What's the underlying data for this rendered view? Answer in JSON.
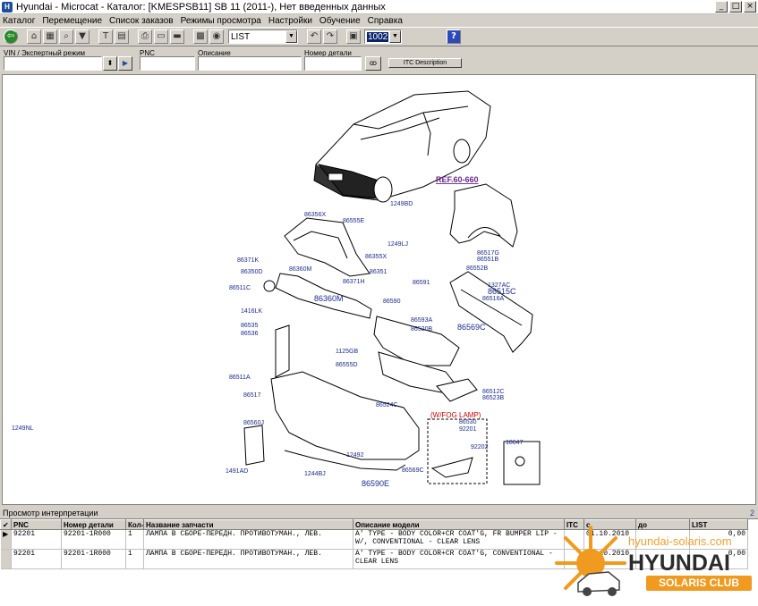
{
  "window": {
    "title": "Hyundai - Microcat - Каталог: [KMESPSB11] SB 11 (2011-), Нет введенных данных"
  },
  "menu": [
    "Каталог",
    "Перемещение",
    "Список заказов",
    "Режимы просмотра",
    "Настройки",
    "Обучение",
    "Справка"
  ],
  "toolbar": {
    "list_value": "LIST",
    "selected_value": "1002"
  },
  "filter": {
    "vin_label": "VIN / Экспертный режим",
    "pnc_label": "PNC",
    "desc_label": "Описание",
    "part_label": "Номер детали",
    "itc_button": "ITC Description"
  },
  "diagram": {
    "callouts": [
      "86356X",
      "86555E",
      "1249LJ",
      "86355X",
      "86371K",
      "86350D",
      "86360M",
      "86351",
      "86371H",
      "86511C",
      "86360M",
      "86590",
      "1416LK",
      "86535",
      "86536",
      "86593A",
      "86520B",
      "86569C",
      "1125GB",
      "86555D",
      "86511A",
      "86517",
      "86560J",
      "86512C",
      "86523B",
      "86524C",
      "1491AD",
      "12492",
      "86569C",
      "1244BJ",
      "86590E",
      "1249BD",
      "86517G",
      "86551B",
      "86552B",
      "86591",
      "1327AC",
      "86515C",
      "86516A",
      "86530",
      "92201",
      "92202",
      "18647",
      "1249NL"
    ],
    "ref_label": "REF.60-660",
    "fog_label": "(W/FOG LAMP)"
  },
  "panel": {
    "title": "Просмотр интерпретации",
    "count": "2",
    "columns": [
      "PNC",
      "Номер детали",
      "Кол-",
      "Название запчасти",
      "Описание модели",
      "ITC",
      "с",
      "до",
      "LIST"
    ],
    "rows": [
      {
        "pnc": "92201",
        "part": "92201-1R000",
        "qty": "1",
        "name": "ЛАМПА В СБОРЕ-ПЕРЕДН. ПРОТИВОТУМАН., ЛЕВ.",
        "desc": "A' TYPE - BODY COLOR+CR COAT'G, FR BUMPER LIP - W/, CONVENTIONAL - CLEAR LENS",
        "itc": "",
        "from": "01.10.2010",
        "to": "",
        "list": "0,00"
      },
      {
        "pnc": "92201",
        "part": "92201-1R000",
        "qty": "1",
        "name": "ЛАМПА В СБОРЕ-ПЕРЕДН. ПРОТИВОТУМАН., ЛЕВ.",
        "desc": "A' TYPE - BODY COLOR+CR COAT'G, CONVENTIONAL - CLEAR LENS",
        "itc": "",
        "from": "15.10.2010",
        "to": "",
        "list": "0,00"
      }
    ]
  },
  "watermark": {
    "url": "hyundai-solaris.com",
    "brand": "HYUNDAI",
    "club": "SOLARIS CLUB"
  },
  "colors": {
    "callout": "#1a2b8c",
    "ref": "#6a2a8a",
    "fog": "#cc0000",
    "brand_orange": "#f09a20"
  }
}
